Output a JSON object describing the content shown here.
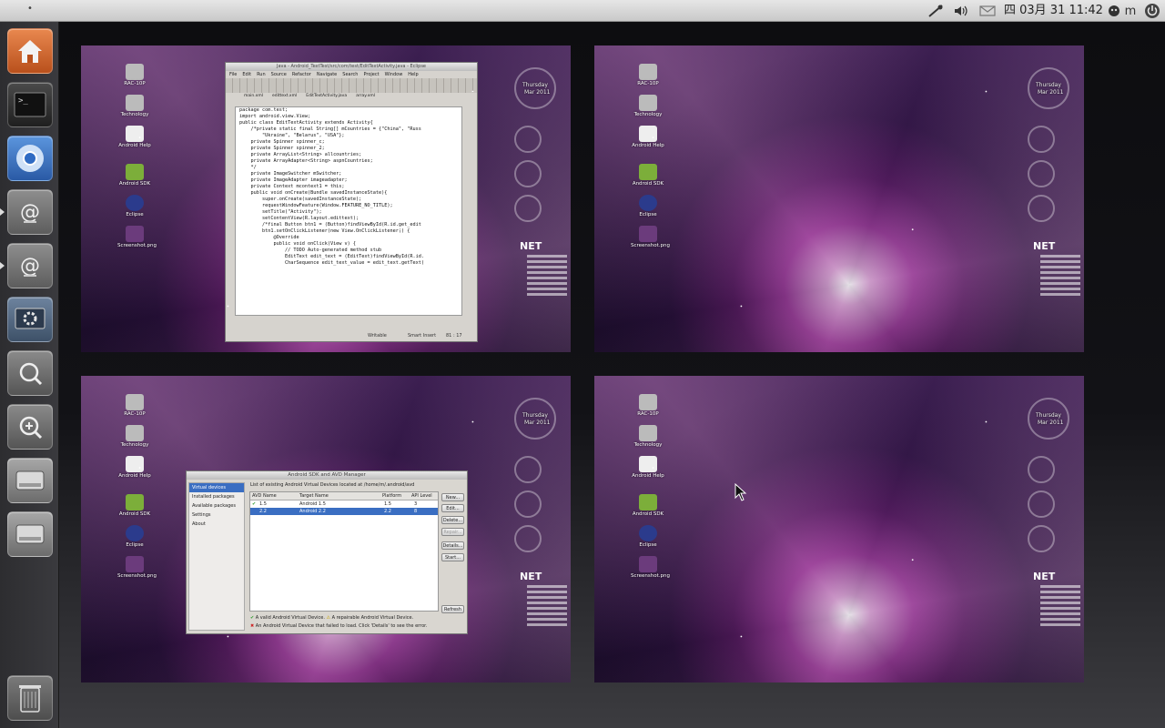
{
  "top_panel": {
    "clock": "四 03月 31 11:42",
    "user": "m",
    "tray_icons": [
      "network-icon",
      "volume-icon",
      "mail-icon",
      "chat-icon",
      "power-icon"
    ]
  },
  "launcher": {
    "items": [
      {
        "name": "home-folder-icon",
        "color": "#d9662b"
      },
      {
        "name": "terminal-icon",
        "color": "#2b2b2b"
      },
      {
        "name": "chromium-icon",
        "color": "#3d78c4"
      },
      {
        "name": "mail-spring-icon",
        "color": "#777777"
      },
      {
        "name": "mail-spring-icon-2",
        "color": "#777777"
      },
      {
        "name": "system-settings-icon",
        "color": "#5a6e86"
      },
      {
        "name": "search-icon",
        "color": "#777777"
      },
      {
        "name": "zoom-icon",
        "color": "#777777"
      },
      {
        "name": "drive-icon",
        "color": "#8a8a8a"
      },
      {
        "name": "drive-icon-2",
        "color": "#8a8a8a"
      },
      {
        "name": "trash-icon",
        "color": "#6e6e6e"
      }
    ]
  },
  "desktop_icons": [
    "RAC-10P",
    "Technology",
    "Android Help",
    "Android SDK",
    "Eclipse",
    "Screenshot.png"
  ],
  "clock_widget": {
    "day": "Thursday",
    "month_year": "Mar 2011"
  },
  "net_widget": {
    "label": "NET"
  },
  "eclipse": {
    "title": "Java - Android_TextTest/src/com/test/EditTextActivity.java - Eclipse",
    "menus": [
      "File",
      "Edit",
      "Run",
      "Source",
      "Refactor",
      "Navigate",
      "Search",
      "Project",
      "Window",
      "Help"
    ],
    "tabs": [
      "main.xml",
      "edittext.xml",
      "EditTextActivity.java",
      "array.xml"
    ],
    "code": [
      "package com.test;",
      "",
      "import android.view.View;",
      "",
      "",
      "",
      "public class EditTextActivity extends Activity{",
      "    /*private static final String[] mCountries = {\"China\", \"Russ",
      "        \"Ukraine\", \"Belarus\", \"USA\"};",
      "    private Spinner spinner_c;",
      "    private Spinner spinner_2;",
      "    private ArrayList<String> allcountries;",
      "    private ArrayAdapter<String> aspnCountries;",
      "    */",
      "    private ImageSwitcher mSwitcher;",
      "    private ImageAdapter imageadapter;",
      "    private Context mcontext1 = this;",
      "    public void onCreate(Bundle savedInstanceState){",
      "        super.onCreate(savedInstanceState);",
      "        requestWindowFeature(Window.FEATURE_NO_TITLE);",
      "        setTitle(\"Activity\");",
      "        setContentView(R.layout.edittext);",
      "",
      "        /*final Button btn1 = (Button)findViewById(R.id.get_edit",
      "        btn1.setOnClickListener(new View.OnClickListener() {",
      "",
      "            @Override",
      "            public void onClick(View v) {",
      "                // TODO Auto-generated method stub",
      "                EditText edit_text = (EditText)findViewById(R.id.",
      "",
      "                CharSequence edit_text_value = edit_text.getText("
    ],
    "status": {
      "mode": "Writable",
      "insert": "Smart Insert",
      "position": "81 : 17"
    }
  },
  "avd_manager": {
    "title": "Android SDK and AVD Manager",
    "sidebar": [
      "Virtual devices",
      "Installed packages",
      "Available packages",
      "Settings",
      "About"
    ],
    "header": "List of existing Android Virtual Devices located at /home/m/.android/avd",
    "columns": [
      "AVD Name",
      "Target Name",
      "Platform",
      "API Level"
    ],
    "rows": [
      {
        "name": "1.5",
        "target": "Android 1.5",
        "platform": "1.5",
        "api": "3"
      },
      {
        "name": "2.2",
        "target": "Android 2.2",
        "platform": "2.2",
        "api": "8"
      }
    ],
    "buttons": [
      "New...",
      "Edit...",
      "Delete...",
      "Repair...",
      "Details...",
      "Start...",
      "Refresh"
    ],
    "legend_valid": "A valid Android Virtual Device.",
    "legend_repairable": "A repairable Android Virtual Device.",
    "legend_failed": "An Android Virtual Device that failed to load. Click 'Details' to see the error."
  }
}
